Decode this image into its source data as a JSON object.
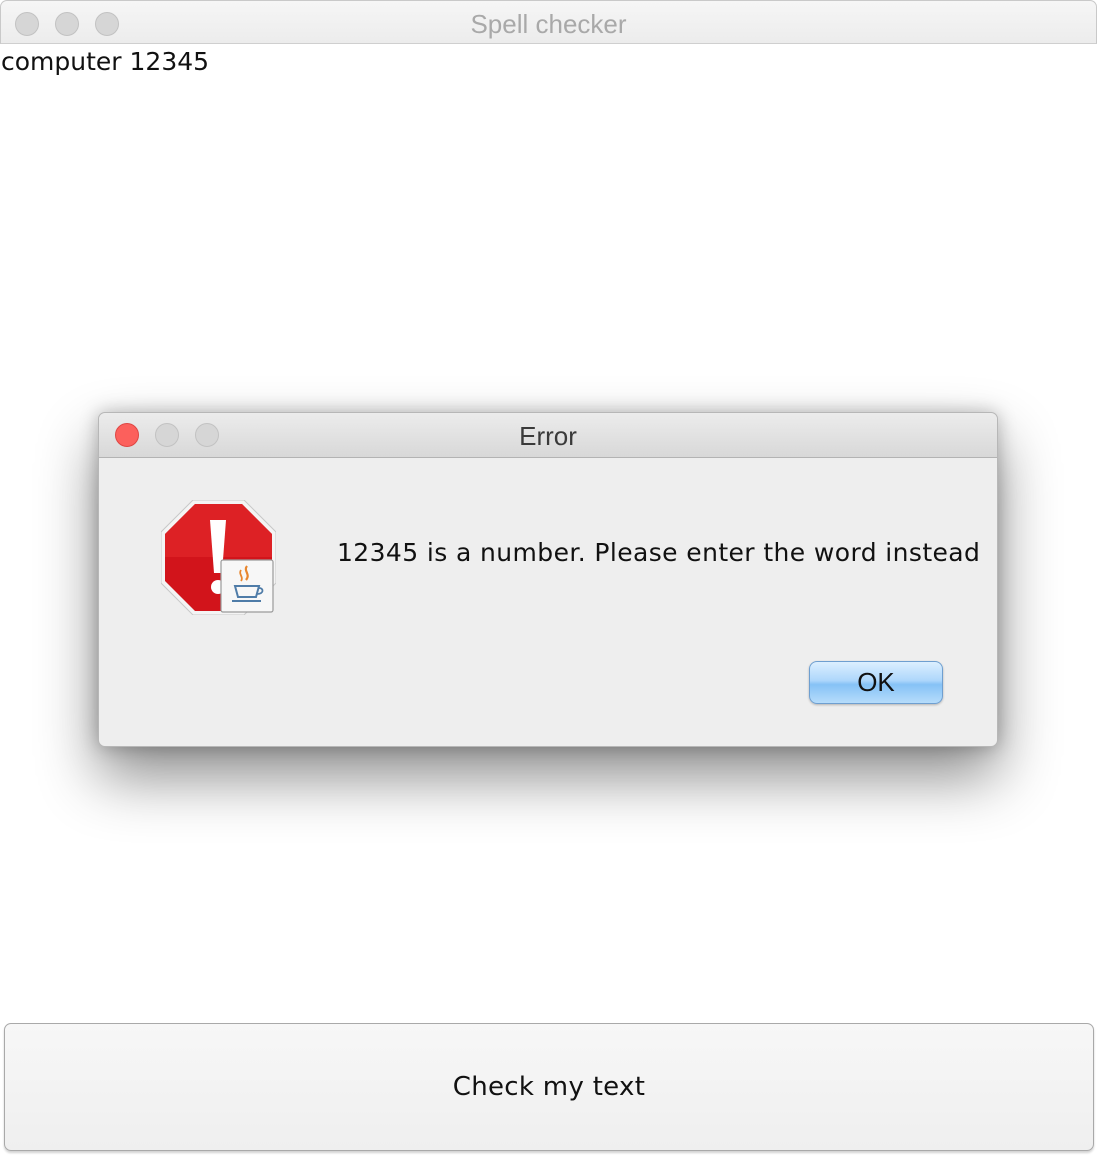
{
  "window": {
    "title": "Spell checker"
  },
  "editor": {
    "text": "computer 12345"
  },
  "check_button": {
    "label": "Check my text"
  },
  "dialog": {
    "title": "Error",
    "message": "12345 is a number. Please enter the word instead",
    "ok_label": "OK",
    "icon": "error-stop-sign-icon",
    "badge_icon": "java-coffee-cup-icon"
  },
  "colors": {
    "close_button": "#fc605c",
    "ok_button_accent": "#86c2f6",
    "stop_sign_red": "#d2141b"
  }
}
